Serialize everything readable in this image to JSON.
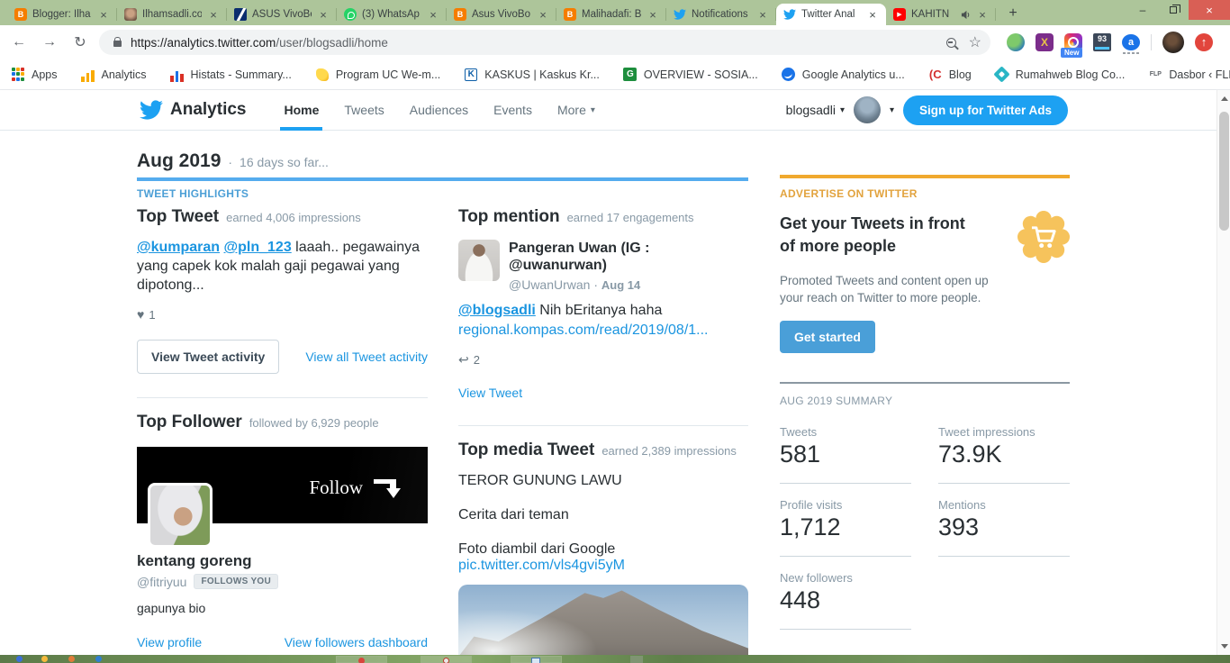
{
  "colors": {
    "accent_blue": "#1da1f2",
    "link_blue": "#1b95e0",
    "orange": "#f0a92e",
    "tabbar_green": "#adc59a"
  },
  "glyphs": {
    "back": "←",
    "forward": "→",
    "reload": "↻",
    "star": "☆",
    "overflow": "»",
    "newtab": "+",
    "minimize": "–",
    "close": "×",
    "chevron": "▾",
    "heart": "♥",
    "reply": "↩",
    "up_arrow": "↑",
    "dot": "·"
  },
  "browser": {
    "tabs": [
      {
        "title": "Blogger: Ilha"
      },
      {
        "title": "Ilhamsadli.co"
      },
      {
        "title": "ASUS VivoBo"
      },
      {
        "title": "(3) WhatsAp"
      },
      {
        "title": "Asus VivoBo"
      },
      {
        "title": "Malihadafi: B"
      },
      {
        "title": "Notifications"
      },
      {
        "title": "Twitter Anal"
      },
      {
        "title": "KAHITN"
      }
    ],
    "address": {
      "scheme_host": "https://analytics.twitter.com",
      "path": "/user/blogsadli/home"
    },
    "extensions": {
      "x_label": "X",
      "insta_badge": "New",
      "counter": "93",
      "a_label": "a"
    },
    "icon_text": {
      "blogger": "B",
      "kaskus": "K",
      "overview": "G",
      "youtube_play": "▶",
      "flp": "FLP"
    },
    "bookmarks": [
      {
        "label": "Apps"
      },
      {
        "label": "Analytics"
      },
      {
        "label": "Histats - Summary..."
      },
      {
        "label": "Program UC We-m..."
      },
      {
        "label": "KASKUS | Kaskus Kr..."
      },
      {
        "label": "OVERVIEW - SOSIA..."
      },
      {
        "label": "Google Analytics u..."
      },
      {
        "label": "Blog"
      },
      {
        "label": "Rumahweb Blog Co..."
      },
      {
        "label": "Dasbor ‹ FLP.or.id..."
      }
    ]
  },
  "nav": {
    "brand": "Analytics",
    "items": [
      {
        "label": "Home"
      },
      {
        "label": "Tweets"
      },
      {
        "label": "Audiences"
      },
      {
        "label": "Events"
      },
      {
        "label": "More"
      }
    ],
    "account": "blogsadli",
    "signup": "Sign up for Twitter Ads"
  },
  "period": {
    "title": "Aug 2019",
    "dot": "·",
    "subtitle": "16 days so far...",
    "section": "TWEET HIGHLIGHTS"
  },
  "top_tweet": {
    "heading": "Top Tweet",
    "sub": "earned 4,006 impressions",
    "mention1": "@kumparan",
    "mention2": "@pln_123",
    "text": " laaah.. pegawainya yang capek kok malah gaji pegawai yang dipotong...",
    "likes": "1",
    "button": "View Tweet activity",
    "link": "View all Tweet activity"
  },
  "top_mention": {
    "heading": "Top mention",
    "sub": "earned 17 engagements",
    "name": "Pangeran Uwan (IG : @uwanurwan)",
    "handle": "@UwanUrwan",
    "dot": "·",
    "date": "Aug 14",
    "mention": "@blogsadli",
    "text": " Nih bEritanya haha",
    "link": "regional.kompas.com/read/2019/08/1...",
    "replies": "2",
    "view": "View Tweet"
  },
  "top_follower": {
    "heading": "Top Follower",
    "sub": "followed by 6,929 people",
    "banner_text": "Follow",
    "name": "kentang goreng",
    "handle": "@fitriyuu",
    "badge": "FOLLOWS YOU",
    "bio": "gapunya bio",
    "view_profile": "View profile",
    "view_dashboard": "View followers dashboard"
  },
  "top_media": {
    "heading": "Top media Tweet",
    "sub": "earned 2,389 impressions",
    "line1": "TEROR GUNUNG LAWU",
    "line2": "Cerita dari teman",
    "line3": "Foto diambil dari Google",
    "link": "pic.twitter.com/vls4gvi5yM"
  },
  "ad": {
    "kicker": "ADVERTISE ON TWITTER",
    "heading": "Get your Tweets in front of more people",
    "body": "Promoted Tweets and content open up your reach on Twitter to more people.",
    "cta": "Get started"
  },
  "summary": {
    "heading": "AUG 2019 SUMMARY",
    "stats": [
      {
        "label": "Tweets",
        "value": "581"
      },
      {
        "label": "Tweet impressions",
        "value": "73.9K"
      },
      {
        "label": "Profile visits",
        "value": "1,712"
      },
      {
        "label": "Mentions",
        "value": "393"
      },
      {
        "label": "New followers",
        "value": "448"
      }
    ]
  }
}
